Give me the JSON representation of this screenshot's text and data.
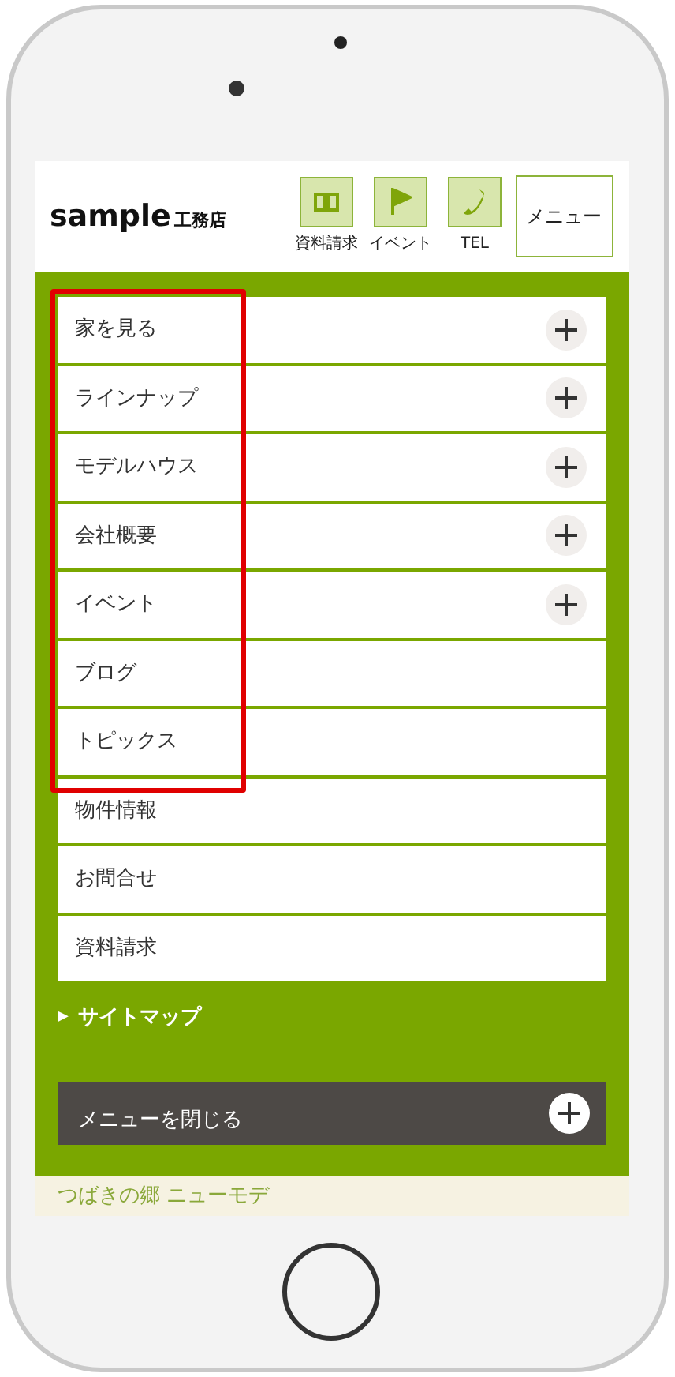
{
  "header": {
    "logo": "sample",
    "logo_suffix": "工務店",
    "icon_buttons": [
      {
        "kind": "book",
        "label": "資料請求"
      },
      {
        "kind": "flag",
        "label": "イベント"
      },
      {
        "kind": "phone",
        "label": "TEL"
      }
    ],
    "menu_button": "メニュー"
  },
  "menu_items": [
    {
      "label": "家を見る",
      "expandable": true
    },
    {
      "label": "ラインナップ",
      "expandable": true
    },
    {
      "label": "モデルハウス",
      "expandable": true
    },
    {
      "label": "会社概要",
      "expandable": true
    },
    {
      "label": "イベント",
      "expandable": true
    },
    {
      "label": "ブログ",
      "expandable": false
    },
    {
      "label": "トピックス",
      "expandable": false
    },
    {
      "label": "物件情報",
      "expandable": false
    },
    {
      "label": "お問合せ",
      "expandable": false
    },
    {
      "label": "資料請求",
      "expandable": false
    }
  ],
  "sitemap_link": {
    "arrow": "▶",
    "label": "サイトマップ"
  },
  "close_button": "メニューを閉じる",
  "footer_text": "つばきの郷 ニューモデ"
}
